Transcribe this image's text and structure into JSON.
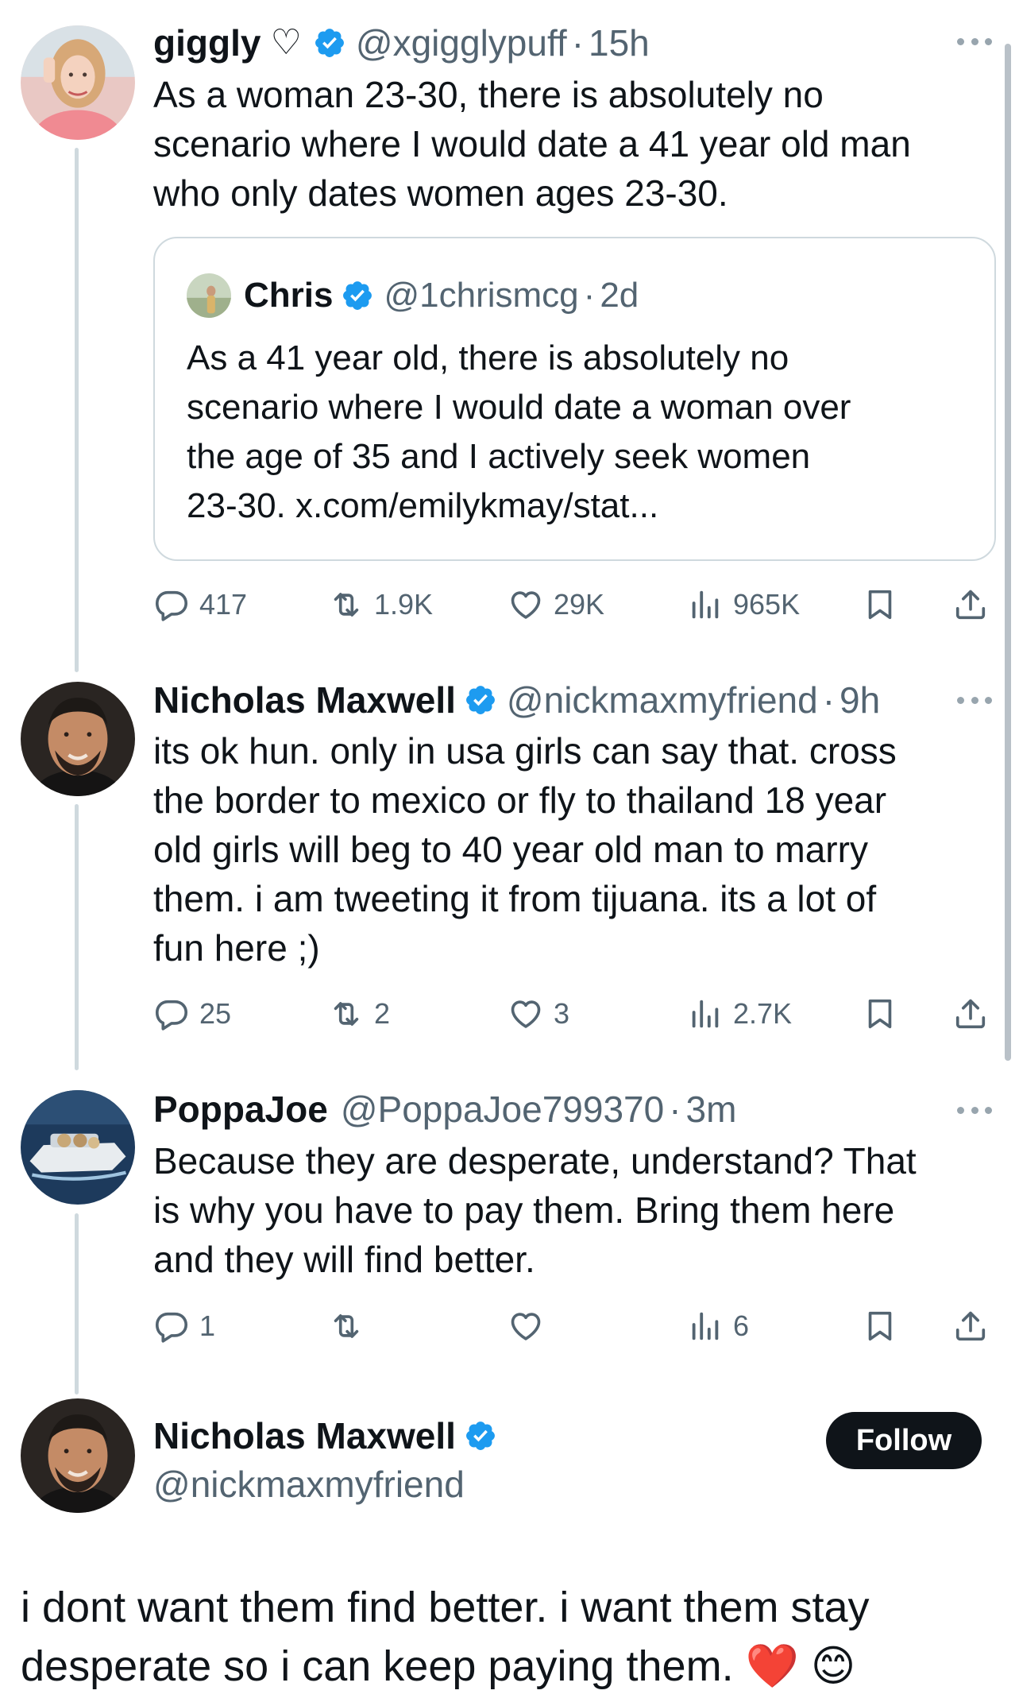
{
  "tweets": [
    {
      "name": "giggly",
      "handle": "@xgigglypuff",
      "time": "15h",
      "text": "As a woman 23-30, there is absolutely no\nscenario where I would date a 41 year old man\nwho only dates women ages 23-30.",
      "quote": {
        "name": "Chris",
        "handle": "@1chrismcg",
        "time": "2d",
        "text": "As a 41 year old, there is absolutely no\nscenario where I would date a woman over\nthe age of 35 and I actively seek women\n23-30. x.com/emilykmay/stat..."
      },
      "stats": {
        "replies": "417",
        "reposts": "1.9K",
        "likes": "29K",
        "views": "965K"
      }
    },
    {
      "name": "Nicholas Maxwell",
      "handle": "@nickmaxmyfriend",
      "time": "9h",
      "text": "its ok hun. only in usa girls can say that. cross\nthe border to mexico or fly to thailand 18 year\nold girls will beg to 40 year old man to marry\nthem. i am tweeting it from tijuana. its a lot of\nfun here ;)",
      "stats": {
        "replies": "25",
        "reposts": "2",
        "likes": "3",
        "views": "2.7K"
      }
    },
    {
      "name": "PoppaJoe",
      "handle": "@PoppaJoe799370",
      "time": "3m",
      "text": "Because they are desperate, understand? That\nis why you have to pay them. Bring them here\nand they will find better.",
      "stats": {
        "replies": "1",
        "reposts": "",
        "likes": "",
        "views": "6"
      }
    }
  ],
  "main_tweet": {
    "name": "Nicholas Maxwell",
    "handle": "@nickmaxmyfriend",
    "follow_label": "Follow",
    "text": "i dont want them find better. i want them stay\ndesperate so i can keep paying them.",
    "emojis": {
      "heart": "❤️",
      "smile": "😊"
    }
  },
  "separator": "·",
  "icons": {
    "verified": "verified-badge-icon",
    "more": "more-options-icon",
    "reply": "reply-icon",
    "repost": "repost-icon",
    "like": "like-icon",
    "views": "views-icon",
    "bookmark": "bookmark-icon",
    "share": "share-icon"
  },
  "colors": {
    "verified_blue": "#1d9bf0",
    "muted": "#536471",
    "text": "#0f1419",
    "border": "#cfd9de"
  }
}
